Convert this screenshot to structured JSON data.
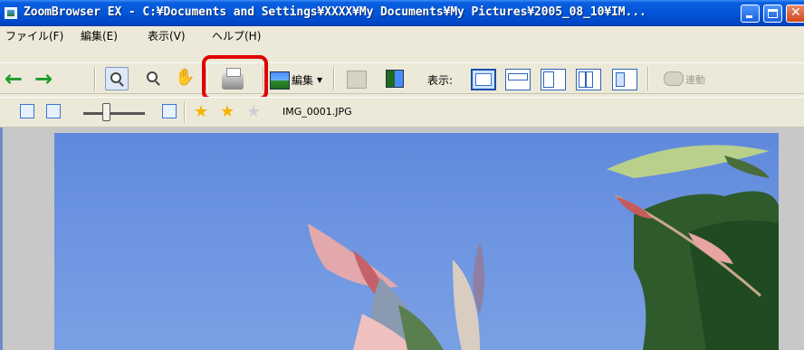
{
  "window": {
    "title": "ZoomBrowser EX - C:¥Documents and Settings¥XXXX¥My Documents¥My Pictures¥2005_08_10¥IM..."
  },
  "menu": {
    "items": [
      "ファイル(F)",
      "編集(E)",
      "表示(V)",
      "ヘルプ(H)"
    ]
  },
  "toolbar": {
    "edit_label": "編集",
    "view_label": "表示:",
    "link_label": "連動"
  },
  "filebar": {
    "filename": "IMG_0001.JPG"
  },
  "colors": {
    "titlebar": "#0355d8",
    "highlight": "#e00000",
    "nav_arrow": "#1d9e2a",
    "sky": "#6b93e0"
  },
  "icons": [
    "back-arrow-icon",
    "forward-arrow-icon",
    "zoom-in-icon",
    "zoom-out-icon",
    "hand-icon",
    "print-icon",
    "edit-icon",
    "view-icons",
    "star-icon"
  ]
}
